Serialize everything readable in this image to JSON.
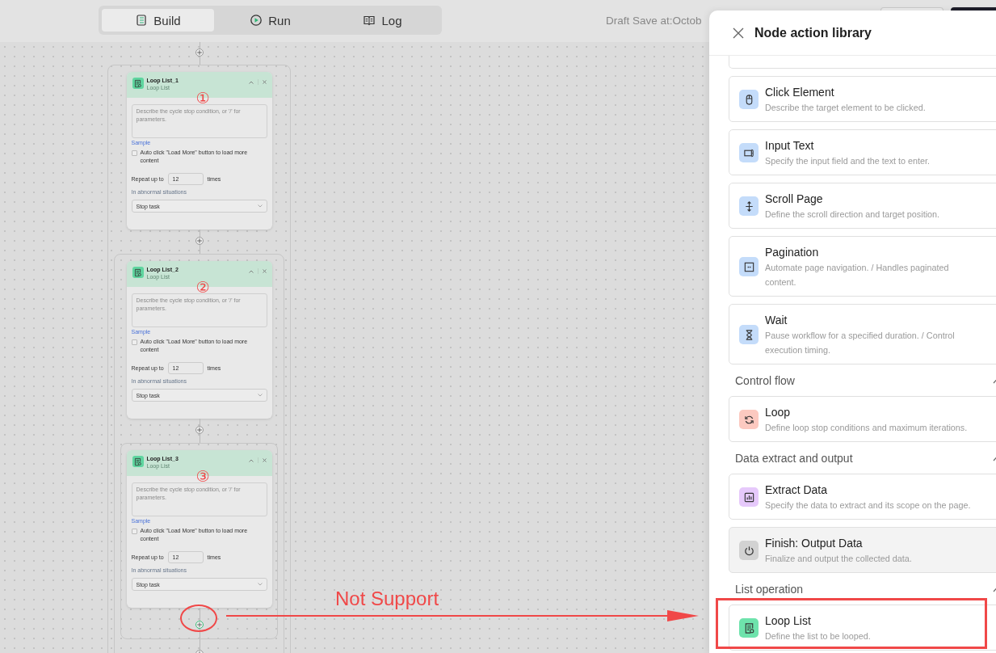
{
  "toolbar": {
    "tabs": [
      {
        "label": "Build",
        "kind": "build",
        "selected": true
      },
      {
        "label": "Run",
        "kind": "run",
        "selected": false
      },
      {
        "label": "Log",
        "kind": "log",
        "selected": false
      }
    ],
    "draft_status": "Draft Save at:Octob"
  },
  "canvas": {
    "nodes": [
      {
        "title": "Loop List_1",
        "subtitle": "Loop List",
        "step": "①",
        "placeholder": "Describe the cycle stop condition, or '/' for parameters.",
        "sample_link": "Sample",
        "auto_click": {
          "label": "Auto click \"Load More\" button to load more content",
          "checked": false
        },
        "repeat": {
          "prefix": "Repeat up to",
          "value": "12",
          "suffix": "times"
        },
        "abnormal": {
          "label": "In abnormal situations",
          "value": "Stop task"
        },
        "add_highlighted": false,
        "children": [
          {
            "title": "Loop List_2",
            "subtitle": "Loop List",
            "step": "②",
            "placeholder": "Describe the cycle stop condition, or '/' for parameters.",
            "sample_link": "Sample",
            "auto_click": {
              "label": "Auto click \"Load More\" button to load more content",
              "checked": false
            },
            "repeat": {
              "prefix": "Repeat up to",
              "value": "12",
              "suffix": "times"
            },
            "abnormal": {
              "label": "In abnormal situations",
              "value": "Stop task"
            },
            "add_highlighted": false,
            "children": [
              {
                "title": "Loop List_3",
                "subtitle": "Loop List",
                "step": "③",
                "placeholder": "Describe the cycle stop condition, or '/' for parameters.",
                "sample_link": "Sample",
                "auto_click": {
                  "label": "Auto click \"Load More\" button to load more content",
                  "checked": false
                },
                "repeat": {
                  "prefix": "Repeat up to",
                  "value": "12",
                  "suffix": "times"
                },
                "abnormal": {
                  "label": "In abnormal situations",
                  "value": "Stop task"
                },
                "add_highlighted": true
              }
            ]
          }
        ]
      }
    ]
  },
  "panel": {
    "title": "Node action library",
    "sections": [
      {
        "items": [
          {
            "title": "Click Element",
            "description": "Describe the target element to be clicked.",
            "kind": "mouse",
            "color": "#c4dcfa",
            "highlighted": false
          },
          {
            "title": "Input Text",
            "description": "Specify the input field and the text to enter.",
            "kind": "input",
            "color": "#c4dcfa",
            "highlighted": false
          },
          {
            "title": "Scroll Page",
            "description": "Define the scroll direction and target position.",
            "kind": "scroll",
            "color": "#c4dcfa",
            "highlighted": false
          },
          {
            "title": "Pagination",
            "description": "Automate page navigation. / Handles paginated content.",
            "kind": "pagination",
            "color": "#c4dcfa",
            "highlighted": false
          },
          {
            "title": "Wait",
            "description": "Pause workflow for a specified duration. / Control execution timing.",
            "kind": "wait",
            "color": "#c4dcfa",
            "highlighted": false
          }
        ]
      },
      {
        "heading": "Control flow",
        "expanded": true,
        "items": [
          {
            "title": "Loop",
            "description": "Define loop stop conditions and maximum iterations.",
            "kind": "loop",
            "color": "#fcc9c0",
            "highlighted": false
          }
        ]
      },
      {
        "heading": "Data extract and output",
        "expanded": true,
        "items": [
          {
            "title": "Extract Data",
            "description": "Specify the data to extract and its scope on the page.",
            "kind": "extract",
            "color": "#e6c9fb",
            "highlighted": false
          },
          {
            "title": "Finish: Output Data",
            "description": "Finalize and output the collected data.",
            "kind": "finish",
            "color": "#d2d2d2",
            "highlighted": true
          }
        ]
      },
      {
        "heading": "List operation",
        "expanded": true,
        "items": [
          {
            "title": "Loop List",
            "description": "Define the list to be looped.",
            "kind": "loop_list",
            "color": "#6ee3ac",
            "highlighted": false
          }
        ]
      }
    ]
  },
  "annotations": {
    "label": "Not Support"
  }
}
